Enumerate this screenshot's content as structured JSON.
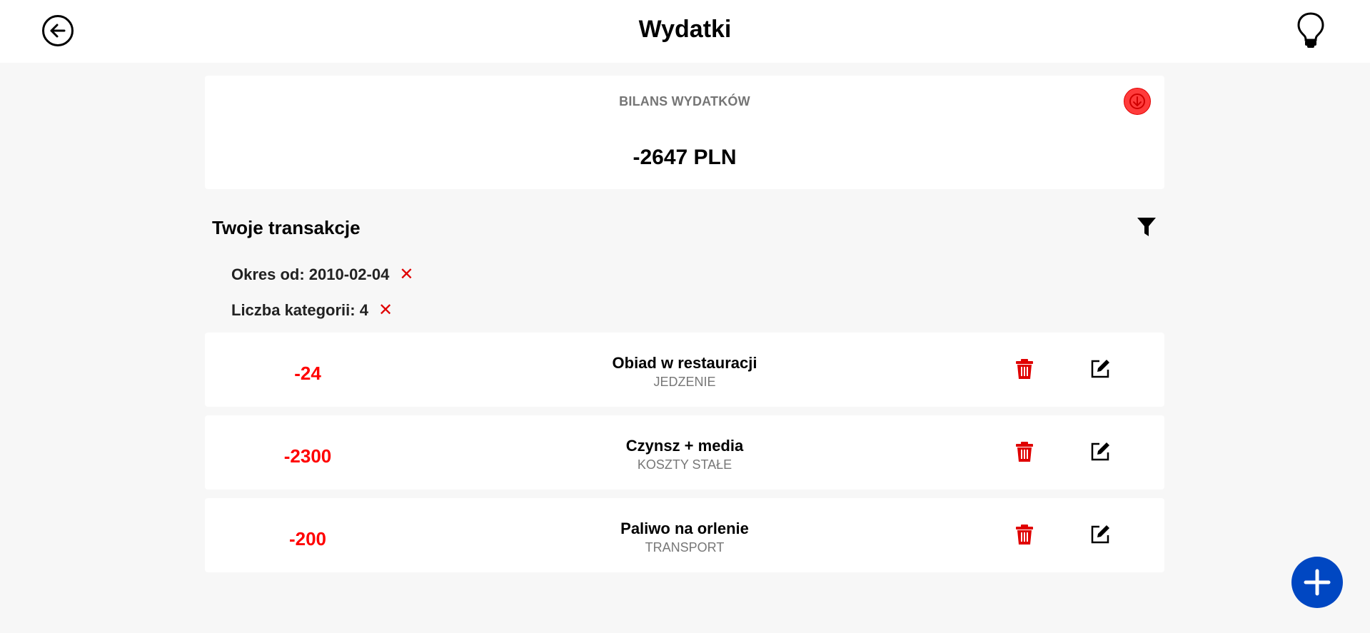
{
  "header": {
    "title": "Wydatki",
    "back_icon": "arrow-left-circle-icon",
    "bulb_icon": "lightbulb-icon"
  },
  "balance": {
    "label": "BILANS WYDATKÓW",
    "amount": "-2647 PLN",
    "indicator_icon": "arrow-down-circle-icon",
    "indicator_color": "#ff3b3b"
  },
  "transactions": {
    "title": "Twoje transakcje",
    "filter_icon": "filter-icon",
    "filters": [
      {
        "label": "Okres od: 2010-02-04",
        "remove_icon": "close-icon"
      },
      {
        "label": "Liczba kategorii: 4",
        "remove_icon": "close-icon"
      }
    ],
    "items": [
      {
        "amount": "-24",
        "title": "Obiad w restauracji",
        "category": "JEDZENIE"
      },
      {
        "amount": "-2300",
        "title": "Czynsz + media",
        "category": "KOSZTY STAŁE"
      },
      {
        "amount": "-200",
        "title": "Paliwo na orlenie",
        "category": "TRANSPORT"
      }
    ]
  },
  "fab": {
    "icon": "plus-icon",
    "color": "#0047c2"
  },
  "colors": {
    "negative": "#ff0000",
    "delete": "#e00000",
    "background": "#f7f7f7"
  }
}
